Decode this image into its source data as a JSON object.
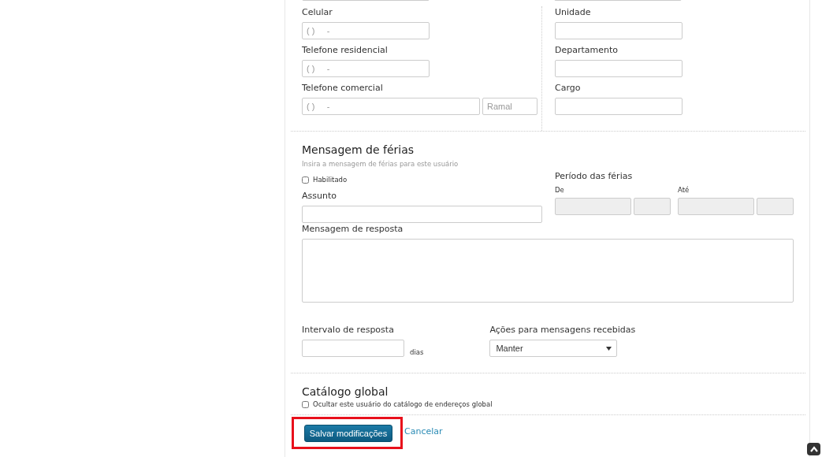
{
  "contact": {
    "left": [
      {
        "label": "Celular",
        "kind": "phone",
        "placeholder": "( )     -"
      },
      {
        "label": "Telefone residencial",
        "kind": "phone",
        "placeholder": "( )     -"
      },
      {
        "label": "Telefone comercial",
        "kind": "phone-ext",
        "placeholder": "( )     -",
        "ext_placeholder": "Ramal"
      }
    ],
    "right": [
      {
        "label": "Unidade"
      },
      {
        "label": "Departamento"
      },
      {
        "label": "Cargo"
      }
    ]
  },
  "vacation": {
    "title": "Mensagem de férias",
    "hint": "Insira a mensagem de férias para este usuário",
    "enabled": {
      "label": "Habilitado",
      "checked": false
    },
    "subject_label": "Assunto",
    "period_label": "Período das férias",
    "from_label": "De",
    "to_label": "Até",
    "reply_label": "Mensagem de resposta",
    "interval_label": "Intervalo de resposta",
    "interval_unit": "dias",
    "actions_label": "Ações para mensagens recebidas",
    "actions_value": "Manter"
  },
  "global_catalog": {
    "title": "Catálogo global",
    "hide": {
      "label": "Ocultar este usuário do catálogo de endereços global",
      "checked": false
    }
  },
  "buttons": {
    "save": "Salvar modificações",
    "save_highlighted": true,
    "cancel": "Cancelar"
  }
}
